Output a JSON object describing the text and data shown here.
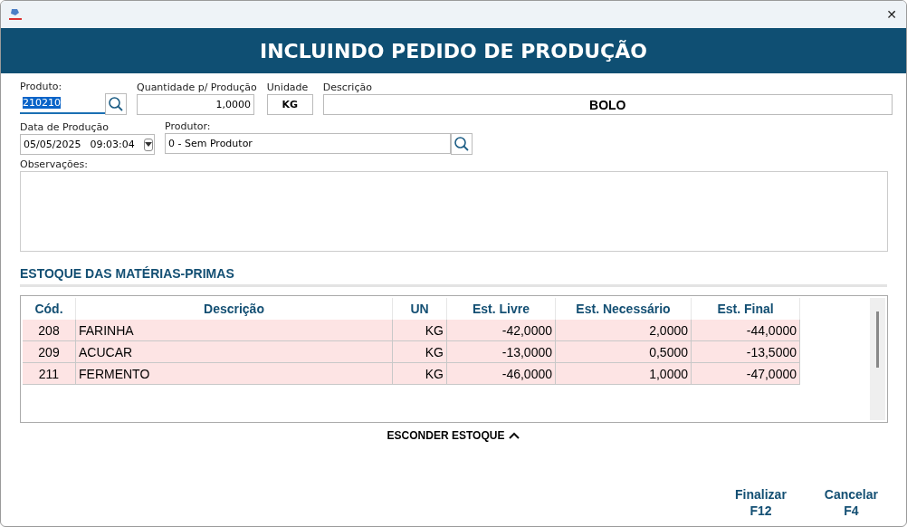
{
  "window": {
    "title": "INCLUINDO PEDIDO DE PRODUÇÃO",
    "close": "✕"
  },
  "form": {
    "produto": {
      "label": "Produto:",
      "value": "210210",
      "focused": true
    },
    "quantidade": {
      "label": "Quantidade p/ Produção",
      "value": "1,0000"
    },
    "unidade": {
      "label": "Unidade",
      "value": "KG"
    },
    "descricao": {
      "label": "Descrição",
      "value": "BOLO"
    },
    "data": {
      "label": "Data de Produção",
      "date": "05/05/2025",
      "time": "09:03:04"
    },
    "produtor": {
      "label": "Produtor:",
      "value": "0 - Sem Produtor"
    },
    "observacoes": {
      "label": "Observações:"
    }
  },
  "stock": {
    "title": "ESTOQUE DAS MATÉRIAS-PRIMAS",
    "columns": [
      "Cód.",
      "Descrição",
      "UN",
      "Est. Livre",
      "Est. Necessário",
      "Est. Final"
    ],
    "rows": [
      {
        "cells": [
          "208",
          "FARINHA",
          "KG",
          "-42,0000",
          "2,0000",
          "-44,0000"
        ],
        "highlighted": true
      },
      {
        "cells": [
          "209",
          "ACUCAR",
          "KG",
          "-13,0000",
          "0,5000",
          "-13,5000"
        ],
        "highlighted": true
      },
      {
        "cells": [
          "211",
          "FERMENTO",
          "KG",
          "-46,0000",
          "1,0000",
          "-47,0000"
        ],
        "highlighted": true
      }
    ],
    "toggle": "ESCONDER ESTOQUE"
  },
  "buttons": [
    {
      "label": "Finalizar",
      "key": "F12"
    },
    {
      "label": "Cancelar",
      "key": "F4"
    }
  ]
}
